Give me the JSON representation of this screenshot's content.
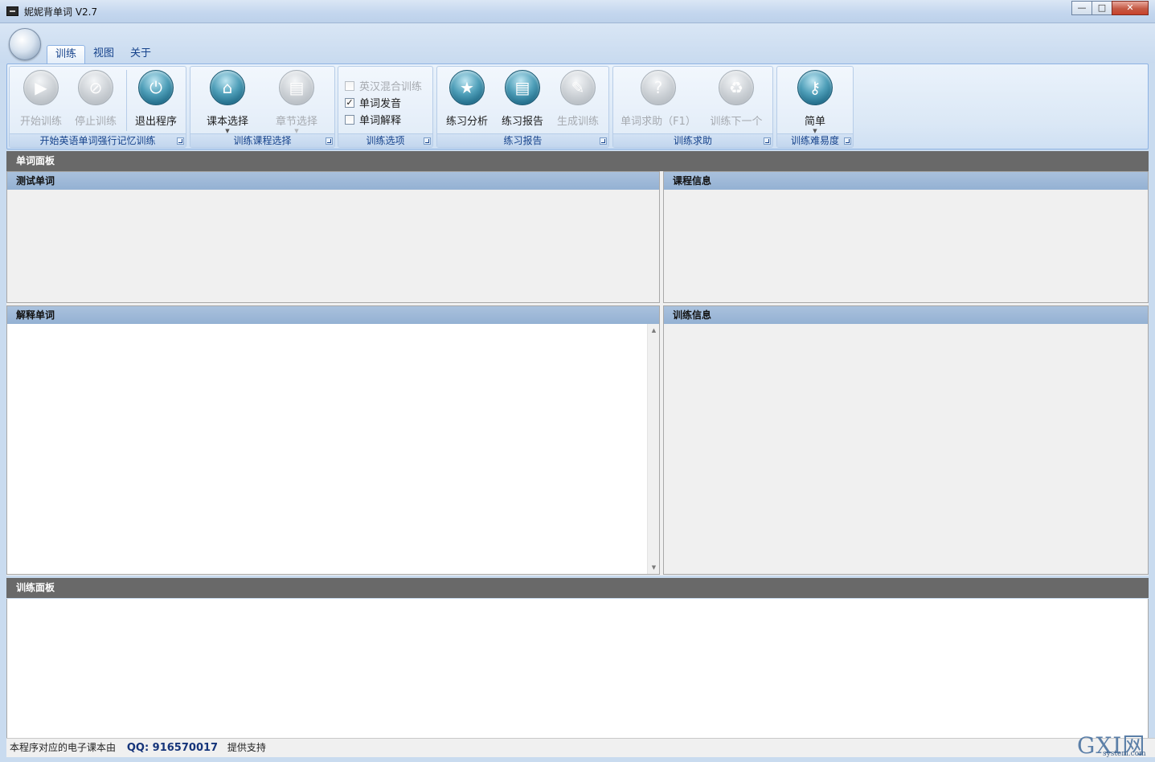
{
  "window": {
    "title": "妮妮背单词 V2.7",
    "buttons": {
      "minimize": "—",
      "maximize": "□",
      "close": "✕"
    }
  },
  "ribbon": {
    "tabs": [
      {
        "label": "训练",
        "active": true
      },
      {
        "label": "视图",
        "active": false
      },
      {
        "label": "关于",
        "active": false
      }
    ],
    "groups": {
      "training": {
        "label": "开始英语单词强行记忆训练",
        "buttons": [
          {
            "label": "开始训练",
            "icon": "play-icon",
            "enabled": false
          },
          {
            "label": "停止训练",
            "icon": "stop-icon",
            "enabled": false
          },
          {
            "label": "退出程序",
            "icon": "power-icon",
            "enabled": true
          }
        ]
      },
      "course": {
        "label": "训练课程选择",
        "buttons": [
          {
            "label": "课本选择",
            "icon": "house-icon",
            "enabled": true,
            "dropdown": true
          },
          {
            "label": "章节选择",
            "icon": "document-icon",
            "enabled": false,
            "dropdown": true
          }
        ]
      },
      "options": {
        "label": "训练选项",
        "checkboxes": [
          {
            "label": "英汉混合训练",
            "checked": false,
            "enabled": false
          },
          {
            "label": "单词发音",
            "checked": true,
            "enabled": true
          },
          {
            "label": "单词解释",
            "checked": false,
            "enabled": true
          }
        ]
      },
      "report": {
        "label": "练习报告",
        "buttons": [
          {
            "label": "练习分析",
            "icon": "star-icon",
            "enabled": true
          },
          {
            "label": "练习报告",
            "icon": "report-icon",
            "enabled": true
          },
          {
            "label": "生成训练",
            "icon": "pen-icon",
            "enabled": false
          }
        ]
      },
      "help": {
        "label": "训练求助",
        "buttons": [
          {
            "label": "单词求助（F1）",
            "icon": "question-icon",
            "enabled": false
          },
          {
            "label": "训练下一个",
            "icon": "recycle-icon",
            "enabled": false
          }
        ]
      },
      "difficulty": {
        "label": "训练难易度",
        "buttons": [
          {
            "label": "简单",
            "icon": "key-icon",
            "enabled": true,
            "dropdown": true
          }
        ]
      }
    }
  },
  "panels": {
    "word_panel": "单词面板",
    "test_word": "测试单词",
    "course_info": "课程信息",
    "explain_word": "解释单词",
    "training_info": "训练信息",
    "training_panel": "训练面板"
  },
  "status": {
    "prefix": "本程序对应的电子课本由",
    "qq": "QQ:  916570017",
    "suffix": "提供支持"
  },
  "watermark": {
    "main": "GXI网",
    "sub": "system.com"
  }
}
